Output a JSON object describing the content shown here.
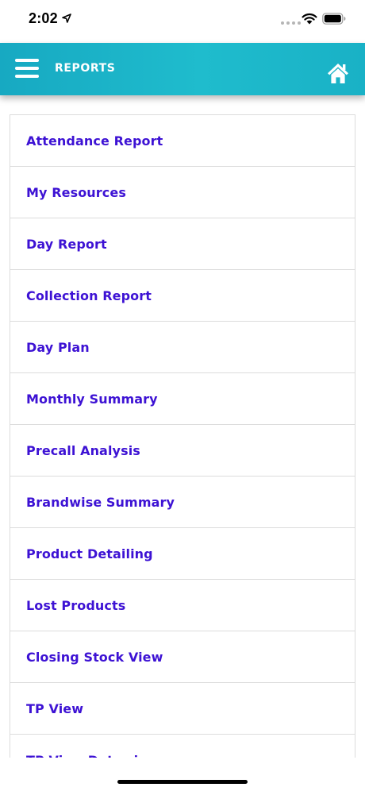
{
  "status_bar": {
    "time": "2:02"
  },
  "header": {
    "title": "REPORTS",
    "menu_icon": "hamburger-menu-icon",
    "home_icon": "home-icon",
    "background_color": "#1fbccd"
  },
  "reports": {
    "label_color": "#3d12d4",
    "items": [
      {
        "label": "Attendance Report"
      },
      {
        "label": "My Resources"
      },
      {
        "label": "Day Report"
      },
      {
        "label": "Collection Report"
      },
      {
        "label": "Day Plan"
      },
      {
        "label": "Monthly Summary"
      },
      {
        "label": "Precall Analysis"
      },
      {
        "label": "Brandwise Summary"
      },
      {
        "label": "Product Detailing"
      },
      {
        "label": "Lost Products"
      },
      {
        "label": "Closing Stock View"
      },
      {
        "label": "TP View"
      },
      {
        "label": "TP View Datewise"
      }
    ]
  }
}
